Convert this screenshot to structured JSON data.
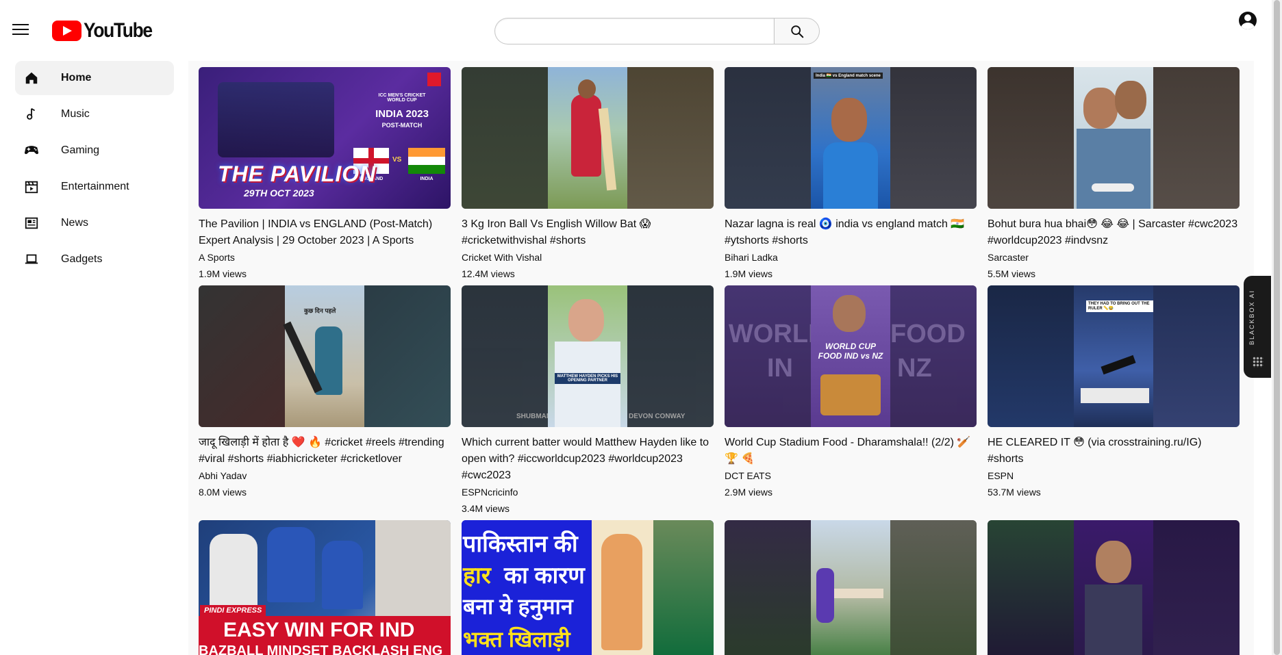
{
  "header": {
    "logo_text": "YouTube",
    "search_placeholder": "",
    "search_value": ""
  },
  "sidebar": {
    "items": [
      {
        "label": "Home",
        "icon": "home-icon",
        "active": true
      },
      {
        "label": "Music",
        "icon": "music-note-icon",
        "active": false
      },
      {
        "label": "Gaming",
        "icon": "gamepad-icon",
        "active": false
      },
      {
        "label": "Entertainment",
        "icon": "clapperboard-icon",
        "active": false
      },
      {
        "label": "News",
        "icon": "newspaper-icon",
        "active": false
      },
      {
        "label": "Gadgets",
        "icon": "laptop-icon",
        "active": false
      }
    ]
  },
  "videos": [
    {
      "title": "The Pavilion | INDIA vs ENGLAND (Post-Match) Expert Analysis | 29 October 2023 | A Sports",
      "channel": "A Sports",
      "views": "1.9M views",
      "thumb": {
        "headline": "THE PAVILION",
        "date": "29TH OCT 2023",
        "event": "INDIA 2023",
        "sub": "POST-MATCH",
        "team_a": "ENGLAND",
        "team_b": "INDIA",
        "vs": "VS",
        "tag": "ICC MEN'S CRICKET WORLD CUP"
      }
    },
    {
      "title": "3 Kg Iron Ball Vs English Willow Bat 😱 #cricketwithvishal #shorts",
      "channel": "Cricket With Vishal",
      "views": "12.4M views"
    },
    {
      "title": "Nazar lagna is real 🧿 india vs england match 🇮🇳 #ytshorts #shorts",
      "channel": "Bihari Ladka",
      "views": "1.9M views",
      "thumb": {
        "caption": "India 🇮🇳 vs England match scene"
      }
    },
    {
      "title": "Bohut bura hua bhai😳 😂 😂 | Sarcaster #cwc2023 #worldcup2023 #indvsnz",
      "channel": "Sarcaster",
      "views": "5.5M views"
    },
    {
      "title": "जादू खिलाड़ी में होता है ❤️ 🔥 #cricket #reels #trending #viral #shorts #iabhicricketer #cricketlover",
      "channel": "Abhi Yadav",
      "views": "8.0M views",
      "thumb": {
        "caption": "कुछ दिन पहले"
      }
    },
    {
      "title": "Which current batter would Matthew Hayden like to open with? #iccworldcup2023 #worldcup2023 #cwc2023",
      "channel": "ESPNcricinfo",
      "views": "3.4M views",
      "thumb": {
        "caption": "MATTHEW HAYDEN PICKS HIS OPENING PARTNER",
        "left": "SHUBMAN",
        "right": "DEVON CONWAY"
      }
    },
    {
      "title": "World Cup Stadium Food - Dharamshala!! (2/2) 🏏 🏆 🍕",
      "channel": "DCT EATS",
      "views": "2.9M views",
      "thumb": {
        "bg_left": "WORLD",
        "bg_right": "FOOD",
        "bg_left2": "IN",
        "bg_right2": "NZ",
        "caption": "WORLD CUP FOOD IND vs NZ"
      }
    },
    {
      "title": "HE CLEARED IT 😳 (via crosstraining.ru/IG) #shorts",
      "channel": "ESPN",
      "views": "53.7M views",
      "thumb": {
        "caption": "THEY HAD TO BRING OUT THE RULER 📏😂"
      }
    },
    {
      "title": "",
      "channel": "",
      "views": "",
      "thumb": {
        "tag": "PINDI EXPRESS",
        "line1": "EASY WIN FOR IND",
        "line2": "BAZBALL MINDSET BACKLASH ENG"
      }
    },
    {
      "title": "",
      "channel": "",
      "views": "",
      "thumb": {
        "line1": "पाकिस्तान की",
        "line2a": "हार",
        "line2b": "का कारण",
        "line3": "बना ये हनुमान",
        "line4": "भक्त खिलाड़ी"
      }
    },
    {
      "title": "",
      "channel": "",
      "views": ""
    },
    {
      "title": "",
      "channel": "",
      "views": ""
    }
  ],
  "blackbox": {
    "label": "BLACKBOX AI"
  },
  "colors": {
    "brand": "#ff0000",
    "active_bg": "#f2f2f2",
    "main_bg": "#f9f9f9"
  }
}
